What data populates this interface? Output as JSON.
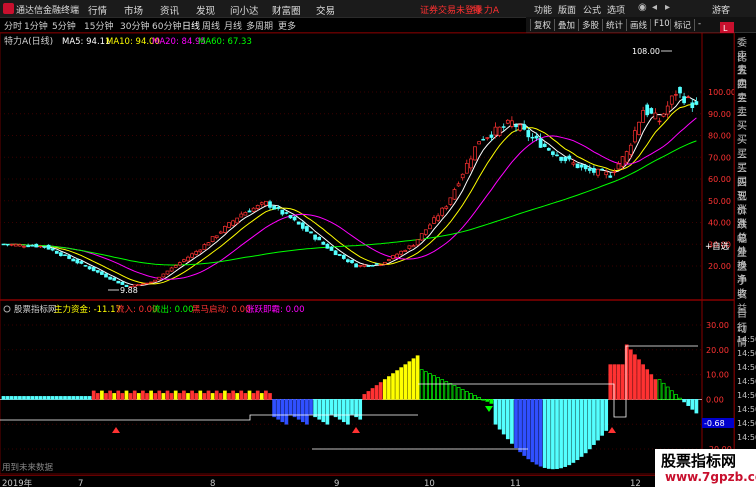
{
  "window": {
    "app_title": "通达信金融终端",
    "menu": [
      "行情",
      "市场",
      "资讯",
      "发现",
      "问小达",
      "财富圈",
      "交易"
    ],
    "warning": "证券交易未登录",
    "stock_title": "特 力A",
    "right_menu": [
      "功能",
      "版面",
      "公式",
      "选项"
    ],
    "guest": "游客"
  },
  "period_tabs": [
    "分时",
    "1分钟",
    "5分钟",
    "15分钟",
    "30分钟",
    "60分钟",
    "日线",
    "周线",
    "月线",
    "多周期",
    "更多"
  ],
  "selected_period": "日线",
  "toolbar_right": [
    "复权",
    "叠加",
    "多股",
    "统计",
    "画线",
    "F10",
    "标记",
    "-"
  ],
  "main_legend": {
    "name": "特力A(日线)",
    "ma5": "MA5: 94.11",
    "ma10": "MA10: 94.00",
    "ma20": "MA20: 84.95",
    "ma60": "MA60: 67.33"
  },
  "price_axis": [
    "100.00",
    "90.00",
    "80.00",
    "70.00",
    "60.00",
    "50.00",
    "40.00",
    "30.00",
    "20.00"
  ],
  "price_annotations": {
    "high": "108.00",
    "low": "9.88"
  },
  "indicator_legend": {
    "name": "股票指标网",
    "main": "主力资金: -11.17",
    "inflow": "流入: 0.00",
    "outflow": "流出: 0.00",
    "dark_horse": "黑马启动: 0.00",
    "leap": "涨跃即霸: 0.00"
  },
  "indicator_axis": [
    "30.00",
    "20.00",
    "10.00",
    "0.00",
    "-10.00",
    "-20.00"
  ],
  "indicator_tag": "-0.68",
  "order_book": [
    "委比",
    "卖五",
    "卖四",
    "卖三",
    "卖二",
    "卖一",
    "买一",
    "买二",
    "买三",
    "买四",
    "买五",
    "现价",
    "涨跌",
    "涨幅",
    "总量",
    "外盘",
    "换手",
    "净资",
    "收益"
  ],
  "order_book_lower": [
    "自动",
    "行情",
    "14:50",
    "14:50",
    "14:50",
    "14:50",
    "14:50",
    "14:50",
    "14:50",
    "14:50"
  ],
  "time_labels": [
    "14:50",
    "14:50",
    "14:50",
    "14:50",
    "14:50",
    "14:50",
    "14:50",
    "14:50"
  ],
  "x_axis": [
    "2019年",
    "7",
    "8",
    "9",
    "10",
    "11",
    "12"
  ],
  "status_text": "用到未来数据",
  "side_buttons": [
    "L",
    "+自选"
  ],
  "watermark": {
    "line1": "股票指标网",
    "line2": "www.7gpzb.com"
  },
  "colors": {
    "up": "#ff3232",
    "down": "#54ffff",
    "ma5": "#ffffff",
    "ma10": "#ffff00",
    "ma20": "#ff00ff",
    "ma60": "#00ff00"
  }
}
